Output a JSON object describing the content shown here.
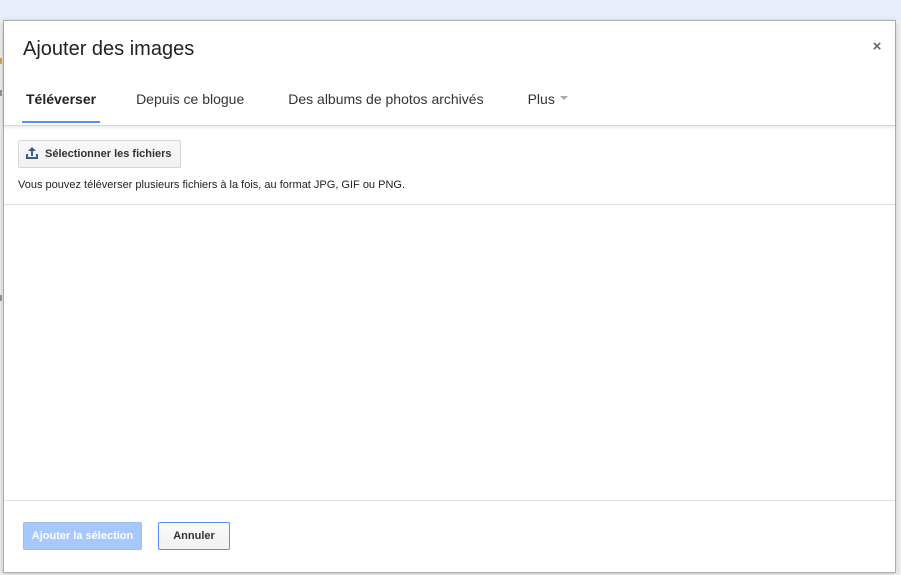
{
  "dialog": {
    "title": "Ajouter des images",
    "close_glyph": "×",
    "close_icon": "close-icon"
  },
  "tabs": [
    {
      "label": "Téléverser",
      "active": true
    },
    {
      "label": "Depuis ce blogue",
      "active": false
    },
    {
      "label": "Des albums de photos archivés",
      "active": false
    },
    {
      "label": "Plus",
      "active": false,
      "has_dropdown": true
    }
  ],
  "upload": {
    "select_button_label": "Sélectionner les fichiers",
    "icon": "upload-icon",
    "hint": "Vous pouvez téléverser plusieurs fichiers à la fois, au format JPG, GIF ou PNG."
  },
  "footer": {
    "add_label": "Ajouter la sélection",
    "add_enabled": false,
    "cancel_label": "Annuler"
  },
  "colors": {
    "accent": "#4d90fe",
    "disabled_primary": "#a6c8ff",
    "background_bar": "#e8effa"
  }
}
